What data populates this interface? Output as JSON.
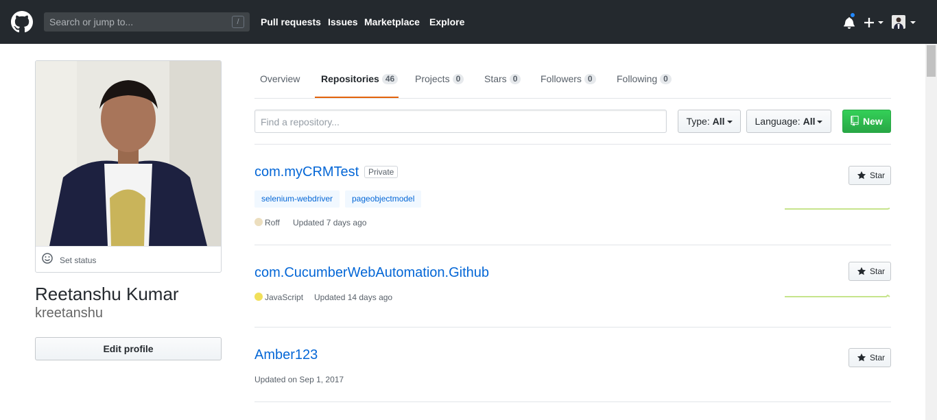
{
  "header": {
    "search_placeholder": "Search or jump to...",
    "search_shortcut": "/",
    "nav": [
      "Pull requests",
      "Issues",
      "Marketplace",
      "Explore"
    ]
  },
  "profile": {
    "set_status": "Set status",
    "full_name": "Reetanshu Kumar",
    "username": "kreetanshu",
    "edit_profile": "Edit profile"
  },
  "tabs": [
    {
      "label": "Overview",
      "count": null
    },
    {
      "label": "Repositories",
      "count": "46"
    },
    {
      "label": "Projects",
      "count": "0"
    },
    {
      "label": "Stars",
      "count": "0"
    },
    {
      "label": "Followers",
      "count": "0"
    },
    {
      "label": "Following",
      "count": "0"
    }
  ],
  "filters": {
    "find_placeholder": "Find a repository...",
    "type_label": "Type:",
    "type_value": "All",
    "language_label": "Language:",
    "language_value": "All",
    "new_label": "New"
  },
  "repos": [
    {
      "name": "com.myCRMTest",
      "badge": "Private",
      "topics": [
        "selenium-webdriver",
        "pageobjectmodel"
      ],
      "language": "Roff",
      "language_color": "#ecdebe",
      "updated": "Updated 7 days ago",
      "star": "Star"
    },
    {
      "name": "com.CucumberWebAutomation.Github",
      "language": "JavaScript",
      "language_color": "#f1e05a",
      "updated": "Updated 14 days ago",
      "star": "Star"
    },
    {
      "name": "Amber123",
      "updated": "Updated on Sep 1, 2017",
      "star": "Star"
    }
  ],
  "colors": {
    "header_bg": "#24292e",
    "link": "#0366d6",
    "active_tab_underline": "#e36209",
    "new_button": "#28a745",
    "notification_dot": "#2188ff"
  }
}
